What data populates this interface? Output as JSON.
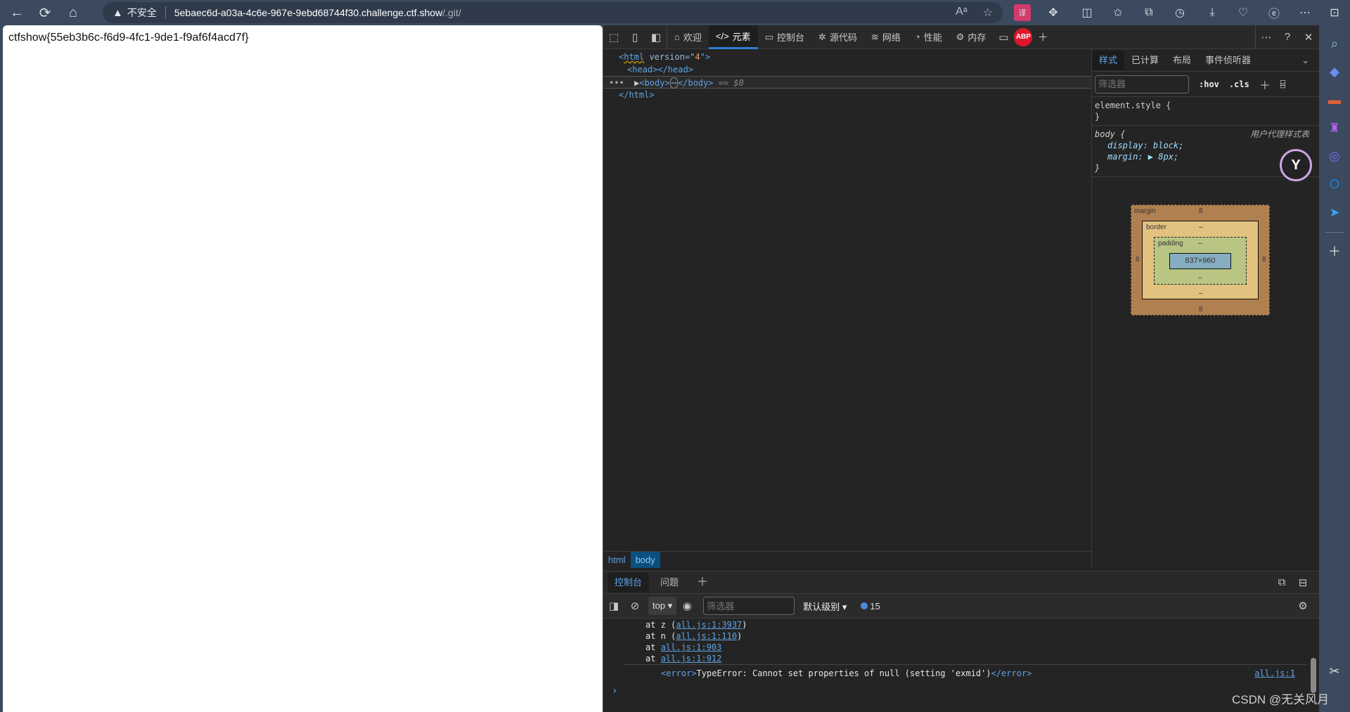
{
  "browser": {
    "nav": {
      "back": "←",
      "refresh": "⟳",
      "home": "⌂"
    },
    "address": {
      "security_label": "不安全",
      "url_host": "5ebaec6d-a03a-4c6e-967e-9ebd68744f30.challenge.ctf.show",
      "url_path": "/.git/"
    },
    "extension_icons": [
      "read-aloud-icon",
      "favorite-star-icon",
      "translate-icon",
      "extensions-icon",
      "split-screen-icon",
      "favorites-icon",
      "collections-icon",
      "history-icon",
      "downloads-icon",
      "performance-icon",
      "ie-mode-icon",
      "more-icon",
      "sidebar-toggle-icon"
    ]
  },
  "page": {
    "flag_text": "ctfshow{55eb3b6c-f6d9-4fc1-9de1-f9af6f4acd7f}"
  },
  "devtools": {
    "tabs": [
      {
        "label": "欢迎",
        "icon": "⌂"
      },
      {
        "label": "元素",
        "icon": "</>",
        "active": true
      },
      {
        "label": "控制台",
        "icon": "▭"
      },
      {
        "label": "源代码",
        "icon": "✲"
      },
      {
        "label": "网络",
        "icon": "≋"
      },
      {
        "label": "性能",
        "icon": "◔"
      },
      {
        "label": "内存",
        "icon": "⚙"
      }
    ],
    "abp_label": "ABP",
    "elements": {
      "line1": {
        "open": "<",
        "tag": "html",
        "attr": " version",
        "eq": "=\"",
        "val": "4",
        "close": "\">"
      },
      "line2": "<head></head>",
      "line3": {
        "tag_open": "<body>",
        "ellipsis": "⋯",
        "tag_close": "</body>",
        "suffix": " == $0"
      },
      "line4": "</html>"
    },
    "breadcrumbs": [
      "html",
      "body"
    ],
    "styles": {
      "tabs": [
        "样式",
        "已计算",
        "布局",
        "事件侦听器"
      ],
      "filter_placeholder": "筛选器",
      "hov": ":hov",
      "cls": ".cls",
      "rules": {
        "element_style_open": "element.style {",
        "element_style_close": "}",
        "body_selector": "body {",
        "user_agent": "用户代理样式表",
        "display": "display: block;",
        "margin": "margin: ▶ 8px;",
        "body_close": "}"
      }
    },
    "box_model": {
      "margin_label": "margin",
      "border_label": "border",
      "padding_label": "padding",
      "margin_top": "8",
      "margin_bottom": "8",
      "margin_left": "8",
      "margin_right": "8",
      "border_value": "–",
      "padding_value": "–",
      "content_size": "837×960"
    },
    "drawer": {
      "tabs": [
        "控制台",
        "问题"
      ],
      "context": "top",
      "filter_placeholder": "筛选器",
      "level": "默认级别",
      "message_count": "15",
      "stack": [
        {
          "prefix": "at z (",
          "link": "all.js:1:3937",
          "suffix": ")"
        },
        {
          "prefix": "at n (",
          "link": "all.js:1:110",
          "suffix": ")"
        },
        {
          "prefix": "at ",
          "link": "all.js:1:903",
          "suffix": ""
        },
        {
          "prefix": "at ",
          "link": "all.js:1:912",
          "suffix": ""
        }
      ],
      "error": {
        "open": "<error>",
        "message": "TypeError: Cannot set properties of null (setting 'exmid')",
        "close": "</error>",
        "source": "all.js:1"
      },
      "prompt": "›"
    }
  },
  "watermark": "CSDN @无关风月"
}
